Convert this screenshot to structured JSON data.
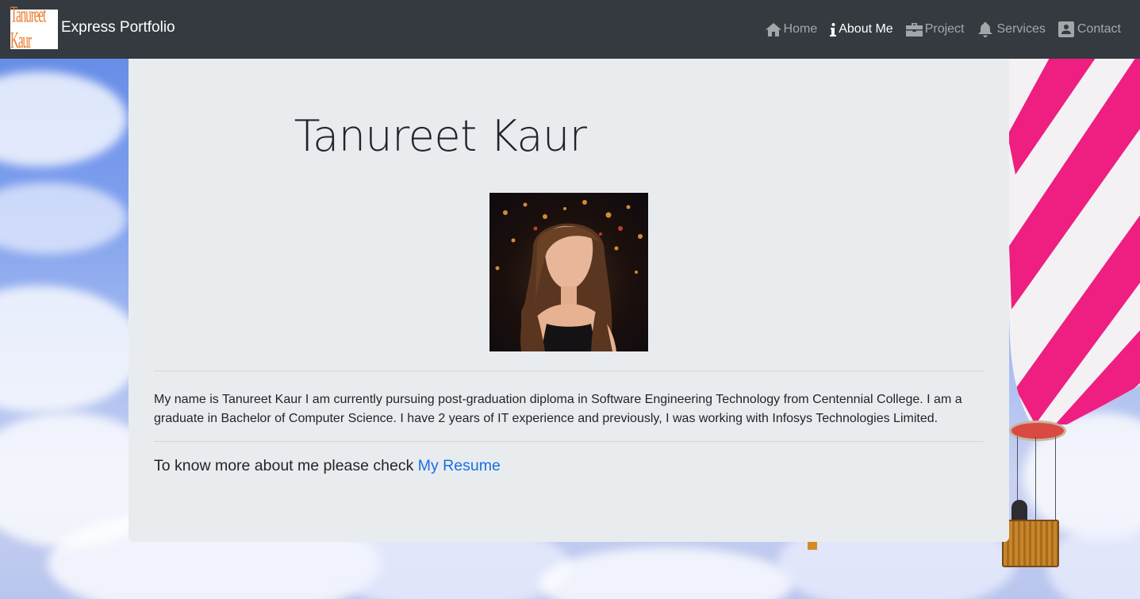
{
  "navbar": {
    "logo_text": "Tanureet Kaur",
    "brand": "Express Portfolio",
    "items": [
      {
        "label": "Home",
        "icon": "home-icon",
        "active": false
      },
      {
        "label": "About Me",
        "icon": "info-icon",
        "active": true
      },
      {
        "label": "Project",
        "icon": "briefcase-icon",
        "active": false
      },
      {
        "label": "Services",
        "icon": "bell-icon",
        "active": false
      },
      {
        "label": "Contact",
        "icon": "contact-card-icon",
        "active": false
      }
    ]
  },
  "main": {
    "title": "Tanureet Kaur",
    "photo_alt": "profile-photo",
    "bio": "My name is Tanureet Kaur I am currently pursuing post-graduation diploma in Software Engineering Technology from Centennial College. I am a graduate in Bachelor of Computer Science. I have 2 years of IT experience and previously, I was working with Infosys Technologies Limited.",
    "more_prefix": "To know more about me please check ",
    "resume_link": "My Resume"
  },
  "colors": {
    "navbar_bg": "#343a40",
    "card_bg": "#e9ecef",
    "link": "#1a6fe0"
  }
}
